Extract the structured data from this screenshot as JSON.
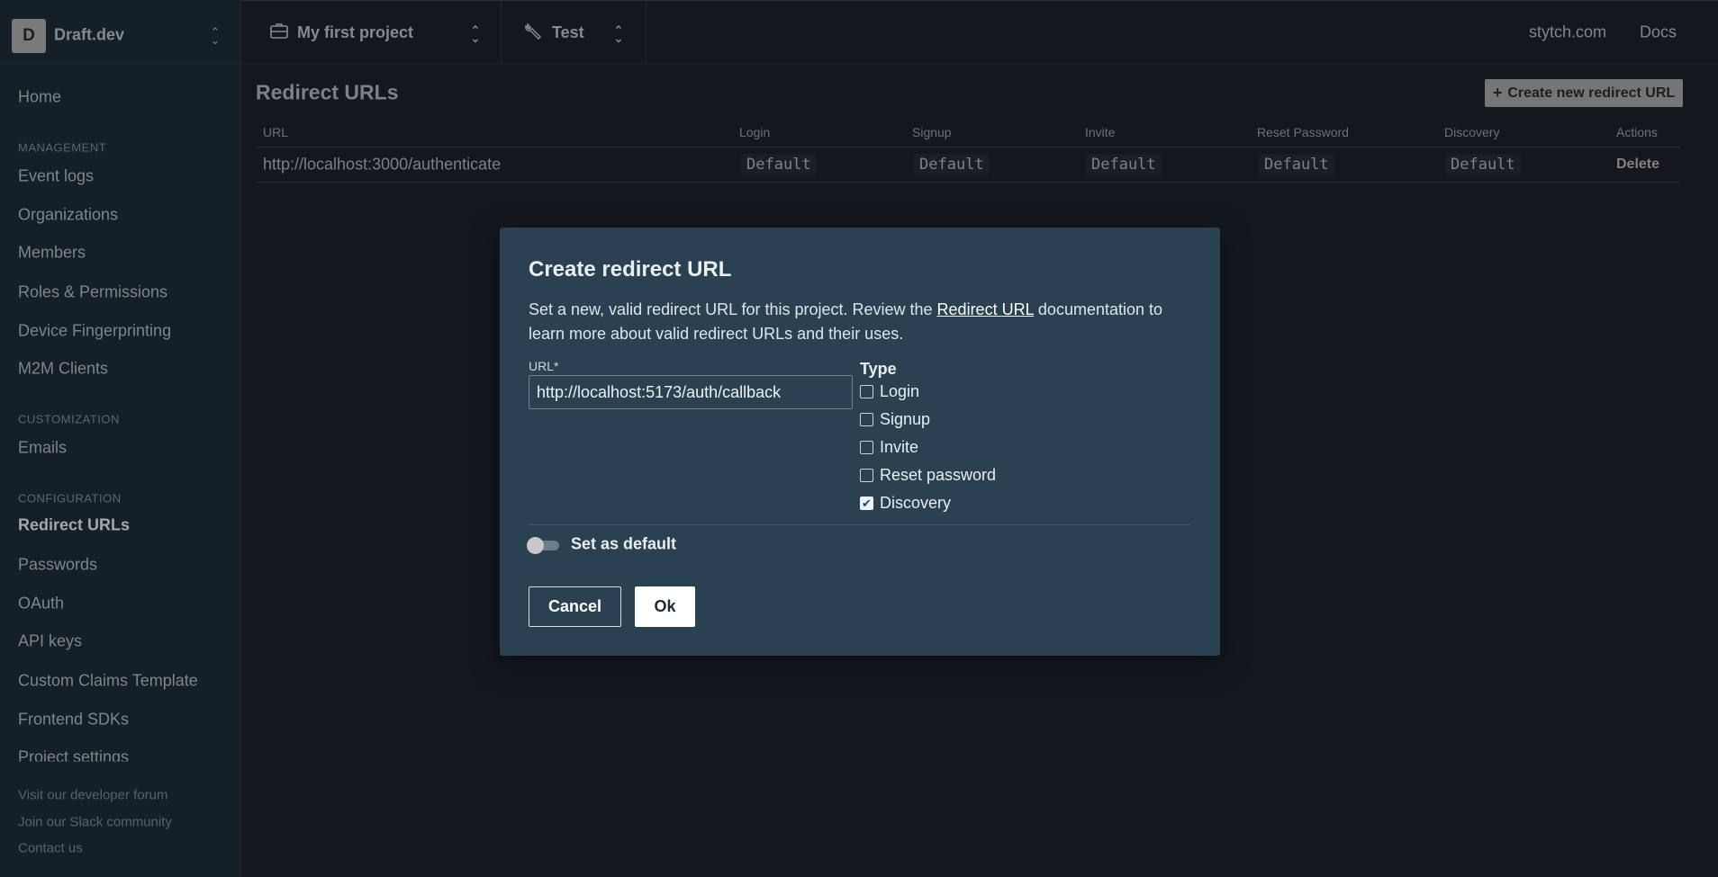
{
  "org": {
    "initial": "D",
    "name": "Draft.dev"
  },
  "topbar": {
    "project": "My first project",
    "environment": "Test",
    "links": [
      "stytch.com",
      "Docs"
    ]
  },
  "sidebar": {
    "home": "Home",
    "sections": [
      {
        "title": "MANAGEMENT",
        "items": [
          "Event logs",
          "Organizations",
          "Members",
          "Roles & Permissions",
          "Device Fingerprinting",
          "M2M Clients"
        ]
      },
      {
        "title": "CUSTOMIZATION",
        "items": [
          "Emails"
        ]
      },
      {
        "title": "CONFIGURATION",
        "items": [
          "Redirect URLs",
          "Passwords",
          "OAuth",
          "API keys",
          "Custom Claims Template",
          "Frontend SDKs",
          "Project settings"
        ]
      }
    ],
    "active": "Redirect URLs",
    "footer": [
      "Visit our developer forum",
      "Join our Slack community",
      "Contact us"
    ]
  },
  "page": {
    "title": "Redirect URLs",
    "create_button": "Create new redirect URL",
    "table": {
      "headers": [
        "URL",
        "Login",
        "Signup",
        "Invite",
        "Reset Password",
        "Discovery",
        "Actions"
      ],
      "rows": [
        {
          "url": "http://localhost:3000/authenticate",
          "login": "Default",
          "signup": "Default",
          "invite": "Default",
          "reset": "Default",
          "discovery": "Default",
          "action": "Delete"
        }
      ]
    }
  },
  "modal": {
    "title": "Create redirect URL",
    "desc_before": "Set a new, valid redirect URL for this project. Review the ",
    "desc_link": "Redirect URL",
    "desc_after": " documentation to learn more about valid redirect URLs and their uses.",
    "url_label": "URL*",
    "url_value": "http://localhost:5173/auth/callback",
    "type_label": "Type",
    "types": [
      {
        "label": "Login",
        "checked": false
      },
      {
        "label": "Signup",
        "checked": false
      },
      {
        "label": "Invite",
        "checked": false
      },
      {
        "label": "Reset password",
        "checked": false
      },
      {
        "label": "Discovery",
        "checked": true
      }
    ],
    "default_toggle": {
      "label": "Set as default",
      "on": false
    },
    "cancel": "Cancel",
    "ok": "Ok"
  }
}
